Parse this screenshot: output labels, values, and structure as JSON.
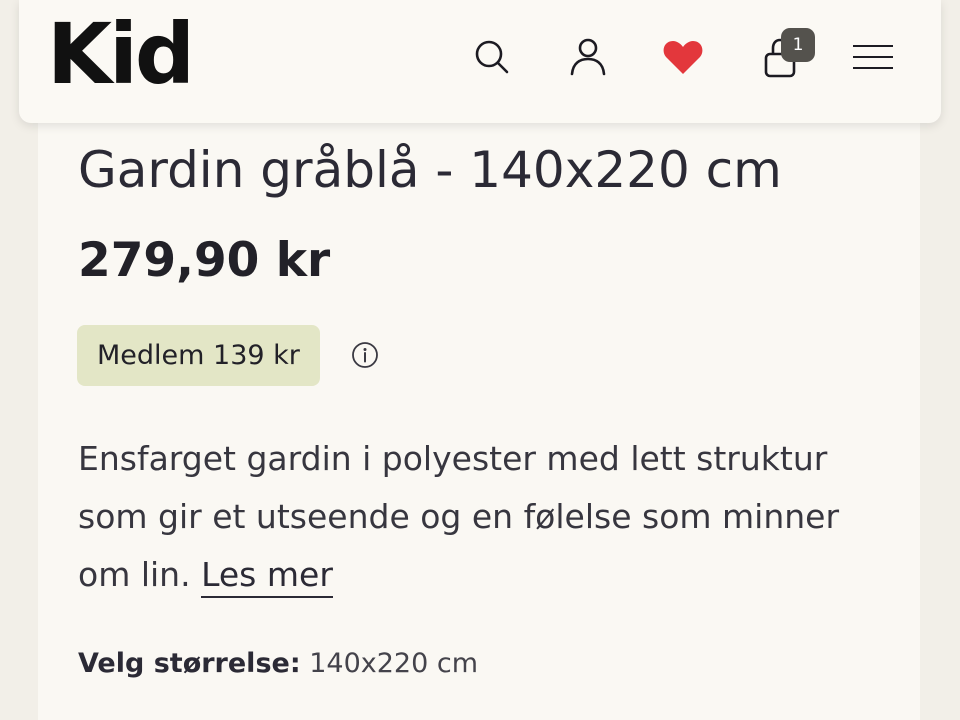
{
  "header": {
    "logo": "Kid",
    "icons": [
      "search-icon",
      "user-icon",
      "heart-icon",
      "cart-icon",
      "menu-icon"
    ],
    "cart_count": "1",
    "heart_color": "#e3373c"
  },
  "product": {
    "title": "Gardin gråblå - 140x220 cm",
    "price": "279,90 kr",
    "member_price": "Medlem 139 kr",
    "member_badge_color": "#e3e6c6",
    "description": "Ensfarget gardin i polyester med lett struktur som gir et utseende og en følelse som minner om lin.",
    "read_more": "Les mer"
  },
  "size": {
    "label": "Velg størrelse:",
    "selected": "140x220 cm"
  }
}
